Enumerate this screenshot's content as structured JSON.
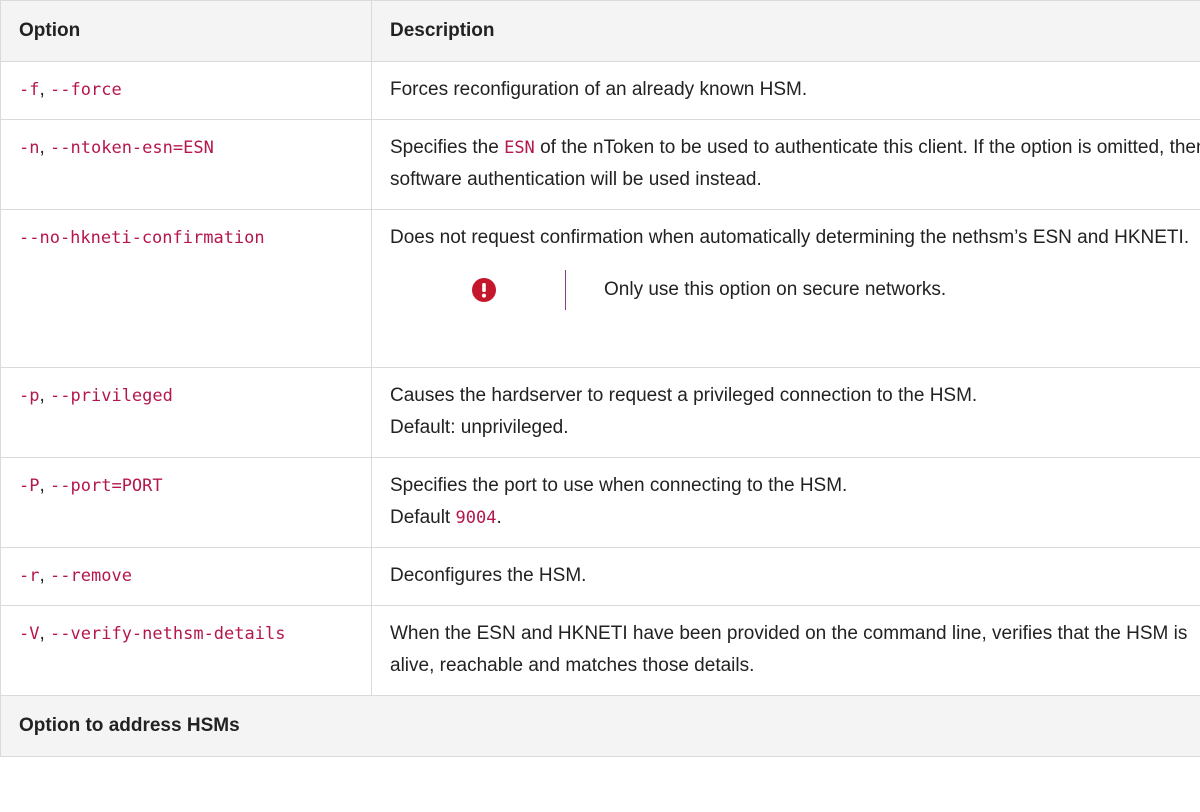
{
  "headers": {
    "option": "Option",
    "description": "Description"
  },
  "rows": [
    {
      "short": "-f",
      "sep": ", ",
      "long": "--force",
      "desc": "Forces reconfiguration of an already known HSM."
    },
    {
      "short": "-n",
      "sep": ", ",
      "long": "--ntoken-esn=ESN",
      "desc_before": "Specifies the ",
      "desc_code": "ESN",
      "desc_after": " of the nToken to be used to authenticate this client. If the option is omitted, then software authentication will be used instead."
    },
    {
      "long": "--no-hkneti-confirmation",
      "desc": "Does not request confirmation when automatically determining the nethsm’s ESN and HKNETI.",
      "warning": "Only use this option on secure networks.",
      "warning_icon": "exclamation-circle-icon",
      "warning_color": "#c4172c"
    },
    {
      "short": "-p",
      "sep": ", ",
      "long": "--privileged",
      "desc_line1": "Causes the hardserver to request a privileged connection to the HSM.",
      "desc_line2": "Default: unprivileged."
    },
    {
      "short": "-P",
      "sep": ", ",
      "long": "--port=PORT",
      "desc_line1": "Specifies the port to use when connecting to the HSM.",
      "desc_line2_before": "Default ",
      "desc_line2_code": "9004",
      "desc_line2_after": "."
    },
    {
      "short": "-r",
      "sep": ", ",
      "long": "--remove",
      "desc": "Deconfigures the HSM."
    },
    {
      "short": "-V",
      "sep": ", ",
      "long": "--verify-nethsm-details",
      "desc": "When the ESN and HKNETI have been provided on the command line, verifies that the HSM is alive, reachable and matches those details."
    }
  ],
  "section": {
    "title": "Option to address HSMs"
  },
  "colors": {
    "code": "#b5174a",
    "header_bg": "#f4f4f4",
    "border": "#dadada",
    "admonition_bar": "#8a3c84"
  }
}
